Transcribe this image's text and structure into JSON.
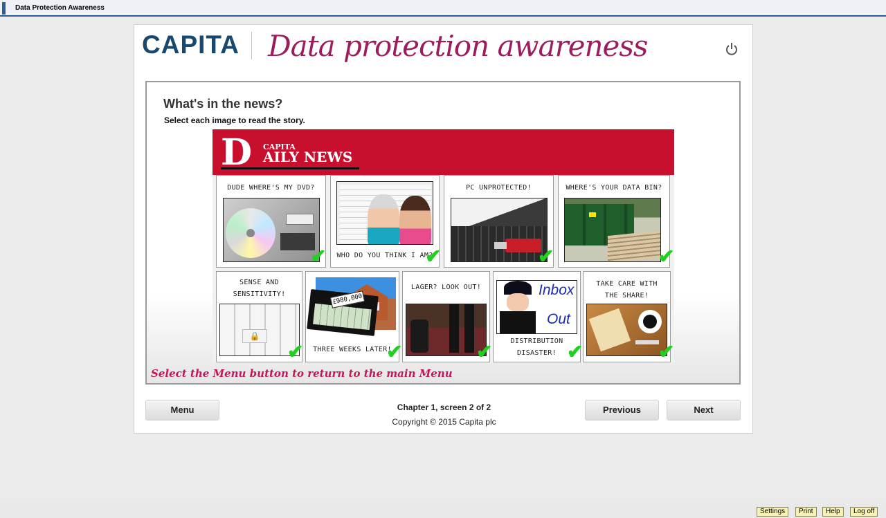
{
  "window": {
    "title": "Data Protection Awareness"
  },
  "header": {
    "brand": "CAPITA",
    "course_title": "Data protection awareness"
  },
  "content": {
    "heading": "What's in the news?",
    "instruction": "Select each image to read the story.",
    "menu_hint": "Select the Menu button to return to the main Menu"
  },
  "newspaper": {
    "mast_d": "D",
    "mast_capita": "CAPITA",
    "mast_daily": "AILY NEWS",
    "stories": [
      {
        "caption": "DUDE WHERE'S MY DVD?",
        "completed": true
      },
      {
        "caption": "WHO DO YOU THINK I AM?",
        "completed": true
      },
      {
        "caption": "PC UNPROTECTED!",
        "completed": true
      },
      {
        "caption": "WHERE'S YOUR DATA BIN?",
        "completed": true
      },
      {
        "caption": "SENSE AND SENSITIVITY!",
        "completed": true
      },
      {
        "caption": "THREE WEEKS LATER!",
        "completed": true,
        "price_tag": "£980,000"
      },
      {
        "caption": "LAGER? LOOK OUT!",
        "completed": true
      },
      {
        "caption": "DISTRIBUTION DISASTER!",
        "completed": true,
        "sign_inbox": "Inbox",
        "sign_out": "Out"
      },
      {
        "caption": "TAKE CARE WITH THE SHARE!",
        "completed": true
      }
    ]
  },
  "nav": {
    "menu_label": "Menu",
    "previous_label": "Previous",
    "next_label": "Next",
    "progress": "Chapter 1, screen 2 of 2",
    "copyright": "Copyright © 2015 Capita plc"
  },
  "bottom_bar": {
    "settings": "Settings",
    "print": "Print",
    "help": "Help",
    "logoff": "Log off"
  },
  "colors": {
    "brand_blue": "#17486f",
    "title_magenta": "#9c1d5c",
    "masthead_red": "#c8102e",
    "tick_green": "#1fd11f",
    "hint_pink": "#c2185b"
  }
}
